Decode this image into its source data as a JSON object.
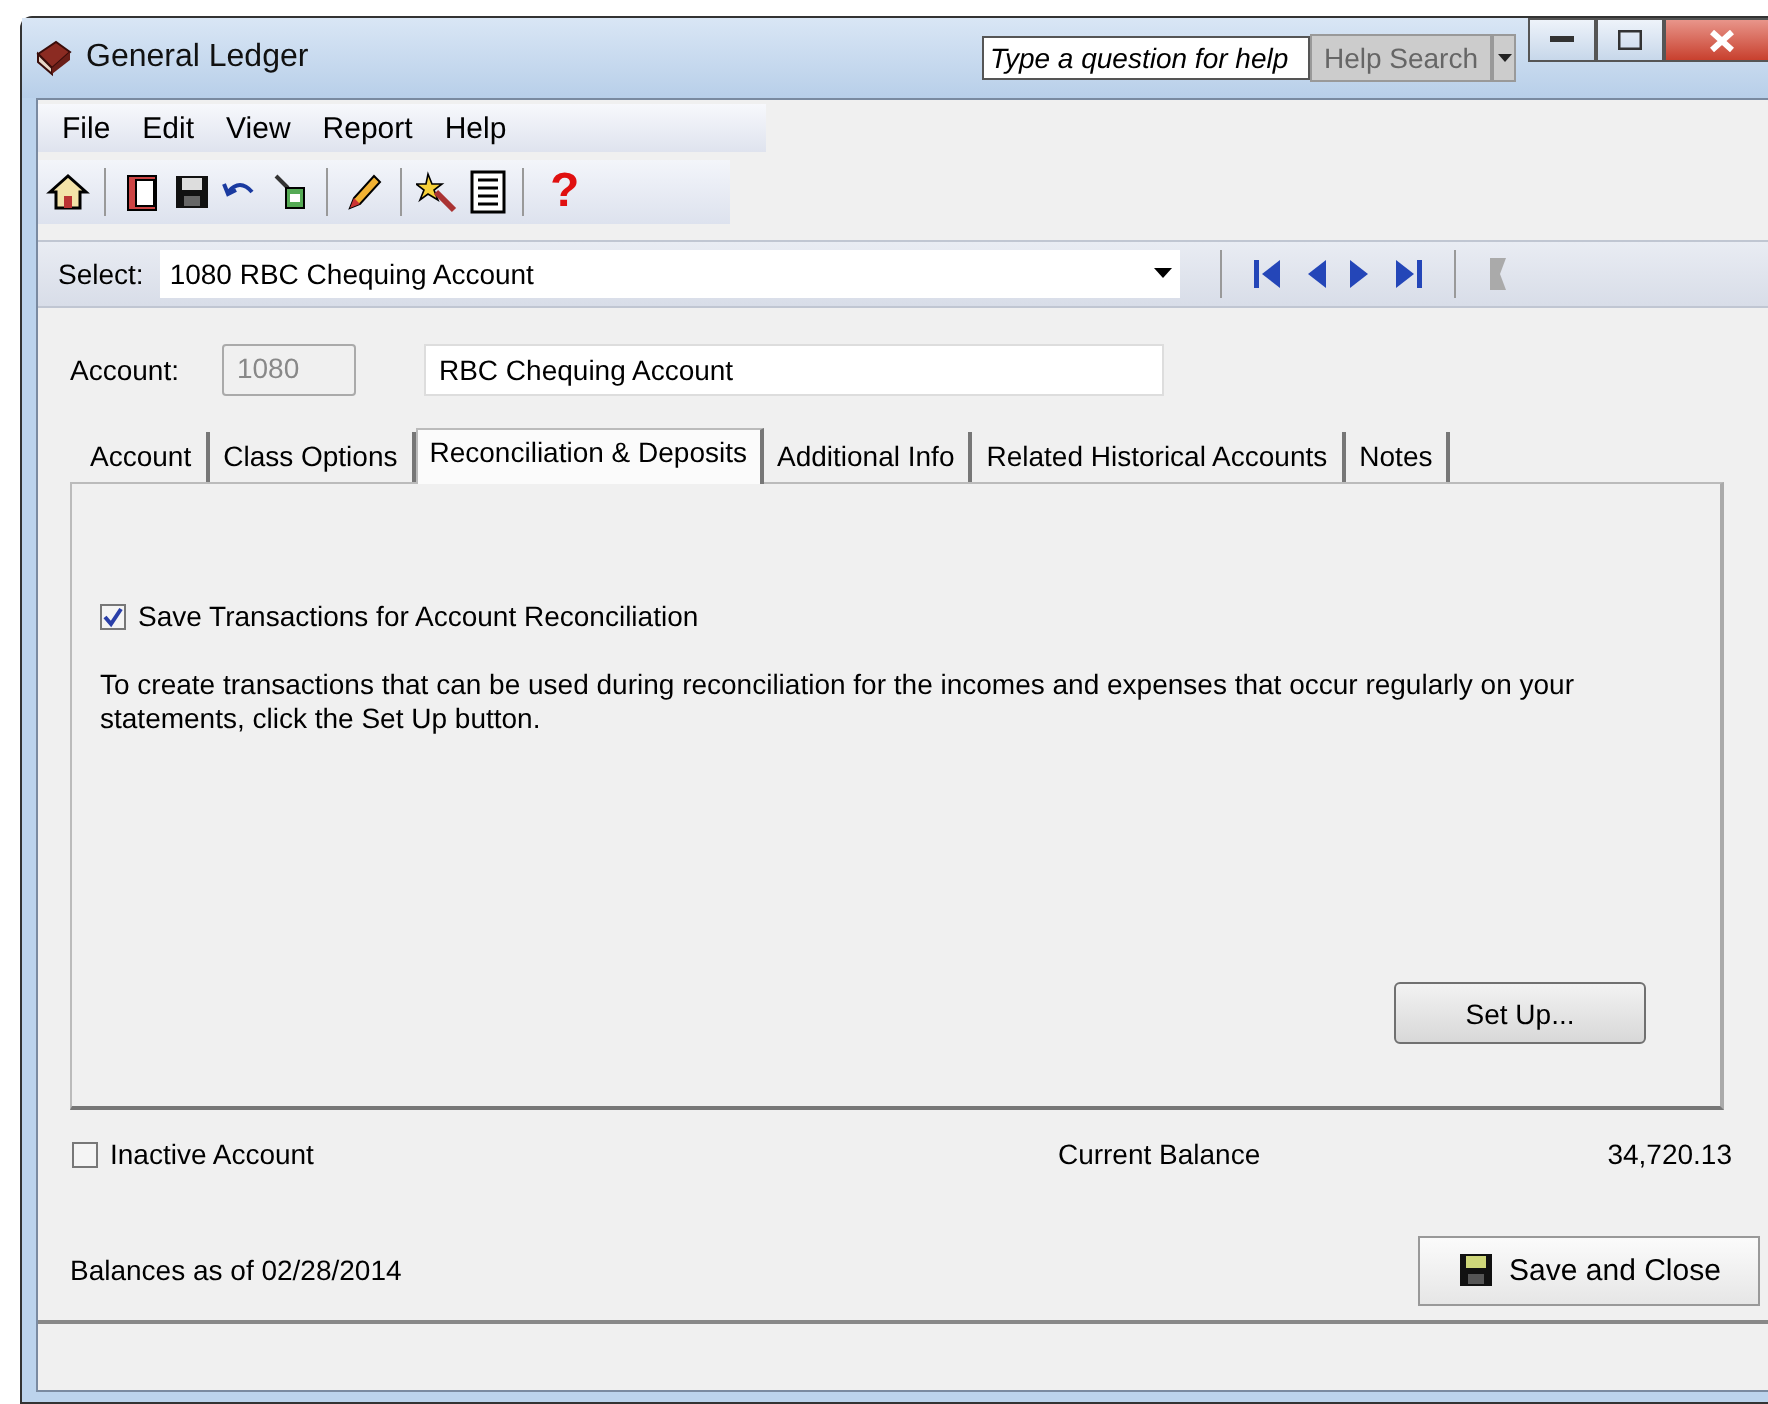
{
  "window": {
    "title": "General Ledger"
  },
  "help": {
    "placeholder": "Type a question for help",
    "button": "Help Search"
  },
  "menu": [
    "File",
    "Edit",
    "View",
    "Report",
    "Help"
  ],
  "toolbar": {
    "help_glyph": "?"
  },
  "select": {
    "label": "Select:",
    "value": "1080 RBC Chequing Account"
  },
  "account": {
    "label": "Account:",
    "number": "1080",
    "number_disabled": true,
    "name": "RBC Chequing Account"
  },
  "tabs": [
    {
      "label": "Account",
      "selected": false
    },
    {
      "label": "Class Options",
      "selected": false
    },
    {
      "label": "Reconciliation & Deposits",
      "selected": true
    },
    {
      "label": "Additional Info",
      "selected": false
    },
    {
      "label": "Related Historical Accounts",
      "selected": false
    },
    {
      "label": "Notes",
      "selected": false
    }
  ],
  "panel": {
    "save_transactions": {
      "label": "Save Transactions for Account Reconciliation",
      "checked": true
    },
    "description": "To create transactions that can be used during reconciliation for the incomes and expenses that occur regularly on your statements, click the Set Up button.",
    "setup_button": "Set Up..."
  },
  "inactive": {
    "label": "Inactive Account",
    "checked": false
  },
  "balance": {
    "label": "Current Balance",
    "value": "34,720.13"
  },
  "balances_as_of": "Balances as of 02/28/2014",
  "save_close_button": "Save and Close"
}
